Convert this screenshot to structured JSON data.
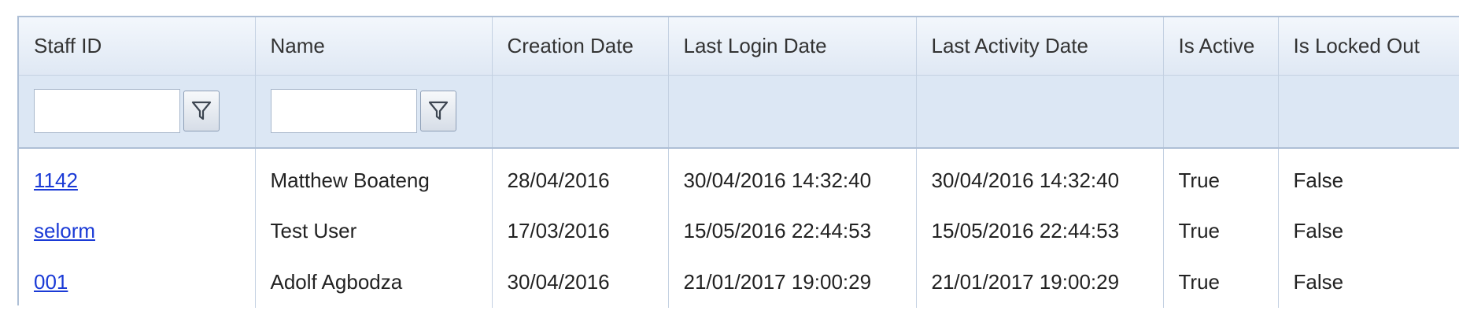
{
  "columns": [
    {
      "label": "Staff ID"
    },
    {
      "label": "Name"
    },
    {
      "label": "Creation Date"
    },
    {
      "label": "Last Login Date"
    },
    {
      "label": "Last Activity Date"
    },
    {
      "label": "Is Active"
    },
    {
      "label": "Is Locked Out"
    }
  ],
  "filters": {
    "staff_id": {
      "value": "",
      "button_icon": "funnel-filter-icon"
    },
    "name": {
      "value": "",
      "button_icon": "funnel-filter-icon"
    }
  },
  "rows": [
    {
      "staff_id": "1142",
      "name": "Matthew Boateng",
      "creation_date": "28/04/2016",
      "last_login": "30/04/2016 14:32:40",
      "last_activity": "30/04/2016 14:32:40",
      "is_active": "True",
      "is_locked_out": "False"
    },
    {
      "staff_id": "selorm",
      "name": "Test User",
      "creation_date": "17/03/2016",
      "last_login": "15/05/2016 22:44:53",
      "last_activity": "15/05/2016 22:44:53",
      "is_active": "True",
      "is_locked_out": "False"
    },
    {
      "staff_id": "001",
      "name": "Adolf Agbodza",
      "creation_date": "30/04/2016",
      "last_login": "21/01/2017 19:00:29",
      "last_activity": "21/01/2017 19:00:29",
      "is_active": "True",
      "is_locked_out": "False"
    }
  ],
  "colors": {
    "header_bg": "#e6edf6",
    "filter_row_bg": "#dce7f4",
    "border": "#aebfd6",
    "link": "#1a3ad6"
  }
}
